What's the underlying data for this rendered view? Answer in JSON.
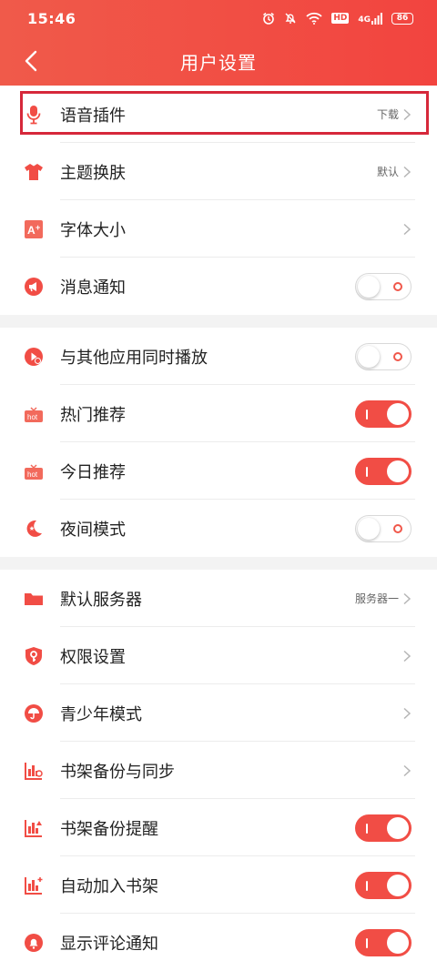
{
  "status_bar": {
    "time": "15:46",
    "network": "4G",
    "hd_label": "HD",
    "battery": "86"
  },
  "header": {
    "title": "用户设置",
    "background": "#f2473f"
  },
  "accent_color": "#f14d45",
  "groups": [
    {
      "items": [
        {
          "label": "语音插件",
          "value": "下载",
          "control": "chevron",
          "icon": "microphone-icon"
        },
        {
          "label": "主题换肤",
          "value": "默认",
          "control": "chevron",
          "icon": "tshirt-icon"
        },
        {
          "label": "字体大小",
          "value": "",
          "control": "chevron",
          "icon": "font-size-icon"
        },
        {
          "label": "消息通知",
          "control": "toggle",
          "on": false,
          "icon": "megaphone-icon"
        }
      ]
    },
    {
      "items": [
        {
          "label": "与其他应用同时播放",
          "control": "toggle",
          "on": false,
          "icon": "play-icon"
        },
        {
          "label": "热门推荐",
          "control": "toggle",
          "on": true,
          "icon": "hot-tv-icon"
        },
        {
          "label": "今日推荐",
          "control": "toggle",
          "on": true,
          "icon": "hot-tv-icon"
        },
        {
          "label": "夜间模式",
          "control": "toggle",
          "on": false,
          "icon": "moon-icon"
        }
      ]
    },
    {
      "items": [
        {
          "label": "默认服务器",
          "value": "服务器一",
          "control": "chevron",
          "icon": "folder-icon"
        },
        {
          "label": "权限设置",
          "value": "",
          "control": "chevron",
          "icon": "shield-key-icon"
        },
        {
          "label": "青少年模式",
          "value": "",
          "control": "chevron",
          "icon": "umbrella-icon"
        },
        {
          "label": "书架备份与同步",
          "value": "",
          "control": "chevron",
          "icon": "bookshelf-sync-icon"
        },
        {
          "label": "书架备份提醒",
          "control": "toggle",
          "on": true,
          "icon": "bookshelf-alert-icon"
        },
        {
          "label": "自动加入书架",
          "control": "toggle",
          "on": true,
          "icon": "bookshelf-add-icon"
        },
        {
          "label": "显示评论通知",
          "control": "toggle",
          "on": true,
          "icon": "bell-icon"
        }
      ]
    }
  ]
}
